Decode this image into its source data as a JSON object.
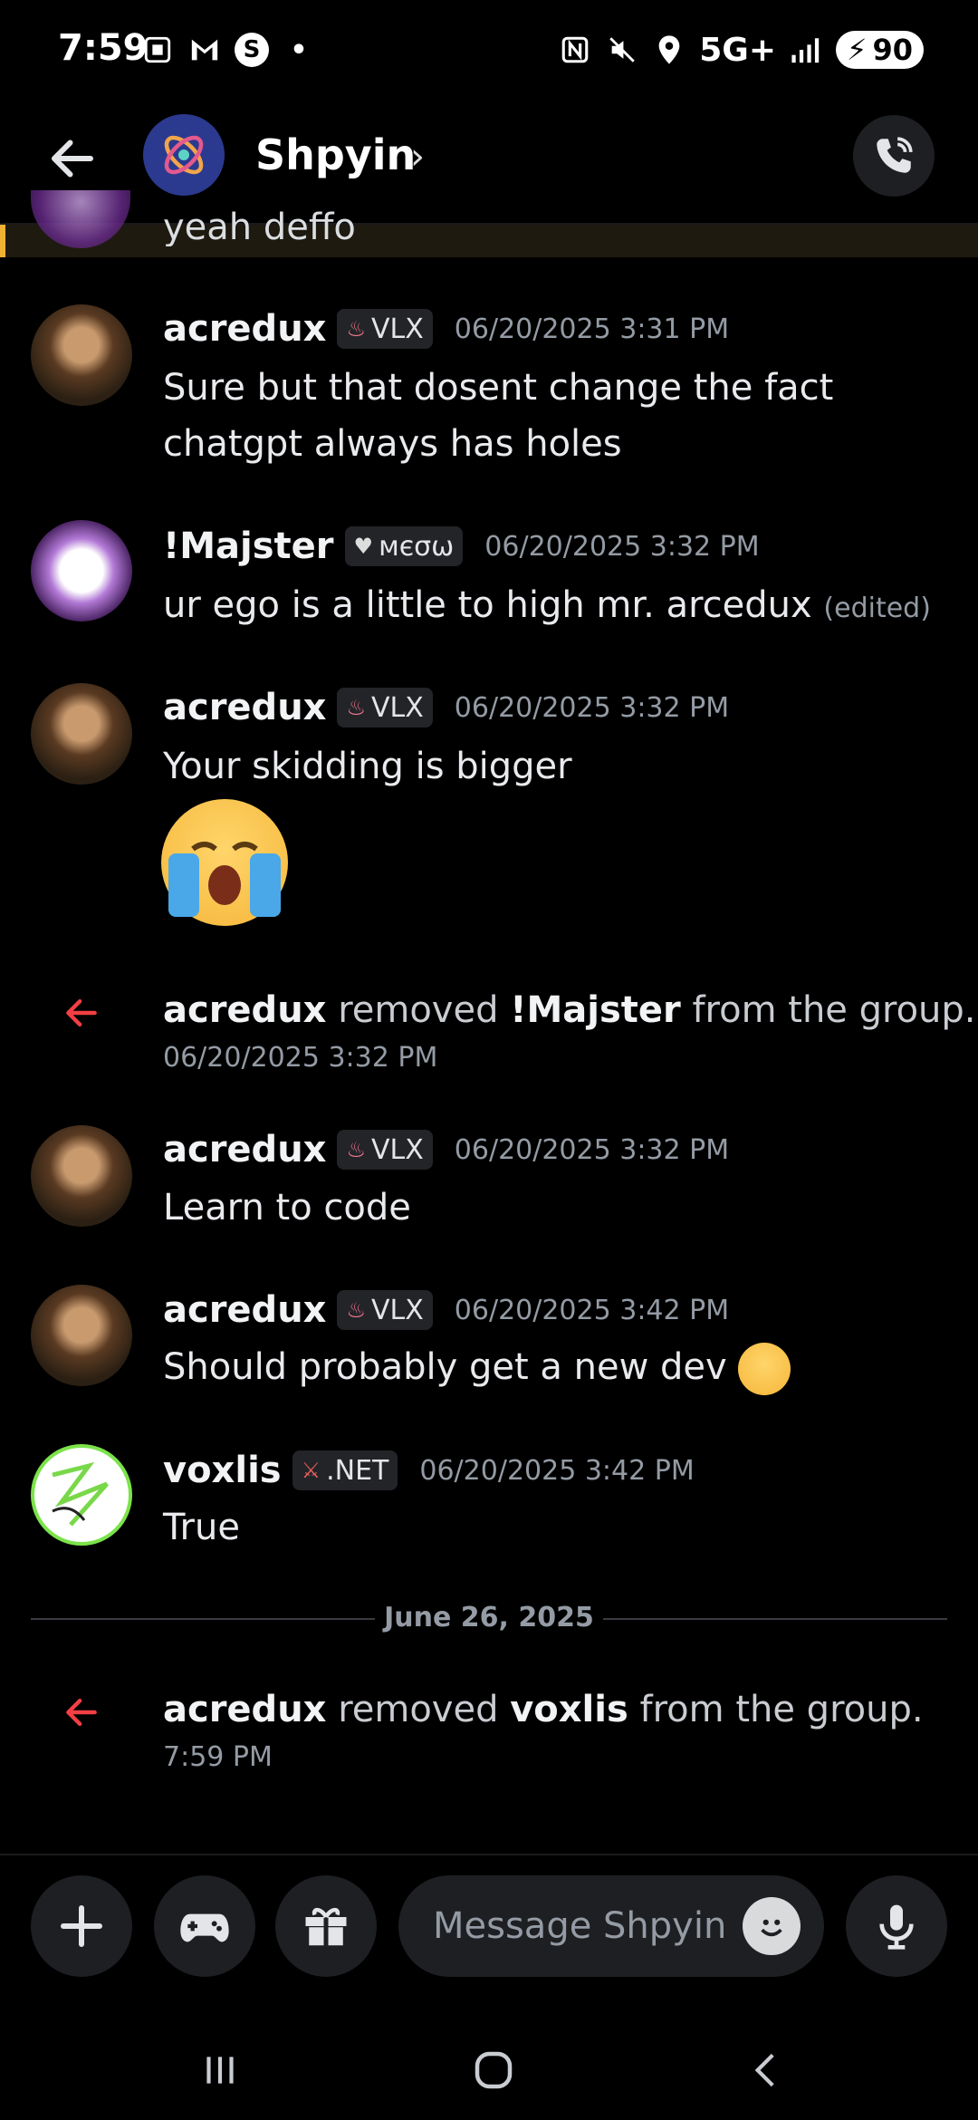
{
  "status": {
    "time": "7:59",
    "network": "5G+",
    "battery": "90"
  },
  "header": {
    "group_name": "Shpyin",
    "chevron": "›"
  },
  "cutoff_message": {
    "text": "yeah deffo"
  },
  "messages": [
    {
      "user": "acredux",
      "tag": "VLX",
      "time": "06/20/2025 3:31 PM",
      "text": "Sure but that dosent change the fact chatgpt always has holes"
    },
    {
      "user": "!Majster",
      "tag": "мєσω",
      "time": "06/20/2025 3:32 PM",
      "text": "ur ego is a little to high mr. arcedux",
      "edited": "(edited)"
    },
    {
      "user": "acredux",
      "tag": "VLX",
      "time": "06/20/2025 3:32 PM",
      "text": "Your skidding is bigger"
    },
    {
      "user": "acredux",
      "tag": "VLX",
      "time": "06/20/2025 3:32 PM",
      "text": "Learn to code"
    },
    {
      "user": "acredux",
      "tag": "VLX",
      "time": "06/20/2025 3:42 PM",
      "text": "Should probably get a new dev"
    },
    {
      "user": "voxlis",
      "tag": ".NET",
      "time": "06/20/2025 3:42 PM",
      "text": "True"
    }
  ],
  "system": [
    {
      "actor": "acredux",
      "action": "removed",
      "target": "!Majster",
      "suffix": "from the group.",
      "time": "06/20/2025 3:32 PM"
    },
    {
      "actor": "acredux",
      "action": "removed",
      "target": "voxlis",
      "suffix": "from the group.",
      "time": "7:59 PM"
    }
  ],
  "divider": {
    "date": "June 26, 2025"
  },
  "composer": {
    "placeholder": "Message Shpyin"
  },
  "icons": [
    "back-arrow-icon",
    "call-icon",
    "plus-icon",
    "gamepad-icon",
    "gift-icon",
    "emoji-icon",
    "mic-icon"
  ],
  "colors": {
    "background": "#000000",
    "accent_red": "#f23f43",
    "highlight_bar": "#f0b232"
  }
}
